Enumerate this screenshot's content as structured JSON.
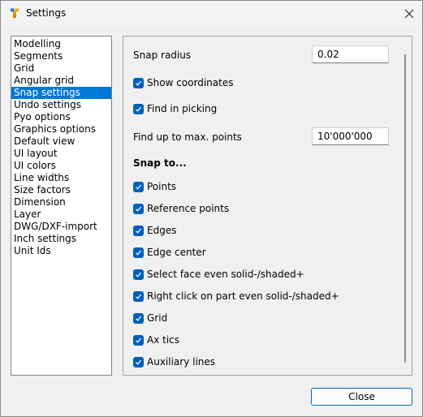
{
  "window": {
    "title": "Settings",
    "icon": "app-logo-icon"
  },
  "sidebar": {
    "items": [
      {
        "label": "Modelling"
      },
      {
        "label": "Segments"
      },
      {
        "label": "Grid"
      },
      {
        "label": "Angular grid"
      },
      {
        "label": "Snap settings",
        "selected": true
      },
      {
        "label": "Undo settings"
      },
      {
        "label": "Pyo options"
      },
      {
        "label": "Graphics options"
      },
      {
        "label": "Default view"
      },
      {
        "label": "UI layout"
      },
      {
        "label": "UI colors"
      },
      {
        "label": "Line widths"
      },
      {
        "label": "Size factors"
      },
      {
        "label": "Dimension"
      },
      {
        "label": "Layer"
      },
      {
        "label": "DWG/DXF-import"
      },
      {
        "label": "Inch settings"
      },
      {
        "label": "Unit Ids"
      }
    ]
  },
  "snap": {
    "radius_label": "Snap radius",
    "radius_value": "0.02",
    "show_coordinates": {
      "label": "Show coordinates",
      "checked": true
    },
    "find_in_picking": {
      "label": "Find in picking",
      "checked": true
    },
    "max_points_label": "Find up to max. points",
    "max_points_value": "10'000'000",
    "snap_to_heading": "Snap to...",
    "snap_targets": [
      {
        "label": "Points",
        "checked": true
      },
      {
        "label": "Reference points",
        "checked": true
      },
      {
        "label": "Edges",
        "checked": true
      },
      {
        "label": "Edge center",
        "checked": true
      },
      {
        "label": "Select face even solid-/shaded+",
        "checked": true
      },
      {
        "label": "Right click on part even solid-/shaded+",
        "checked": true
      },
      {
        "label": "Grid",
        "checked": true
      },
      {
        "label": "Ax tics",
        "checked": true
      },
      {
        "label": "Auxiliary lines",
        "checked": true
      }
    ]
  },
  "footer": {
    "close_label": "Close"
  },
  "colors": {
    "accent": "#0078d7",
    "checkbox": "#005fb8"
  }
}
